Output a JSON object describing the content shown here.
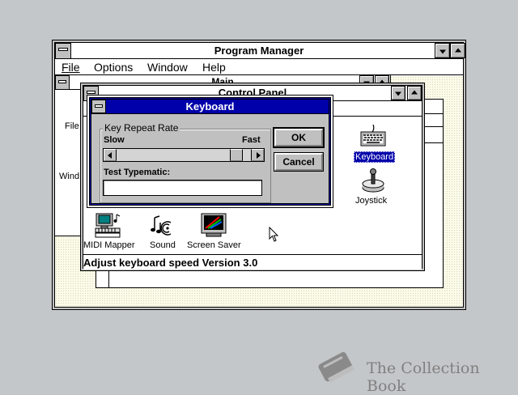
{
  "program_manager": {
    "title": "Program Manager",
    "menu": [
      {
        "label": "File"
      },
      {
        "label": "Options"
      },
      {
        "label": "Window"
      },
      {
        "label": "Help"
      }
    ]
  },
  "main_group": {
    "title": "Main",
    "side_labels": [
      "File",
      "Wind"
    ]
  },
  "control_panel": {
    "title": "Control Panel",
    "icons": [
      {
        "label": "Keyboard",
        "icon": "keyboard-icon"
      },
      {
        "label": "Joystick",
        "icon": "joystick-icon"
      },
      {
        "label": "MIDI Mapper",
        "icon": "midi-mapper-icon"
      },
      {
        "label": "Sound",
        "icon": "sound-icon"
      },
      {
        "label": "Screen Saver",
        "icon": "screen-saver-icon"
      }
    ],
    "status": "Adjust keyboard speed Version 3.0"
  },
  "keyboard_dialog": {
    "title": "Keyboard",
    "group_label": "Key Repeat Rate",
    "slow": "Slow",
    "fast": "Fast",
    "repeat_rate_fraction": 0.93,
    "test_label": "Test Typematic:",
    "test_value": "",
    "ok": "OK",
    "cancel": "Cancel"
  },
  "watermark": {
    "text": "The Collection Book"
  },
  "colors": {
    "desktop": "#c4c7c9",
    "caption_active": "#0000aa",
    "selection": "#0000aa",
    "face": "#c0c0c0"
  }
}
